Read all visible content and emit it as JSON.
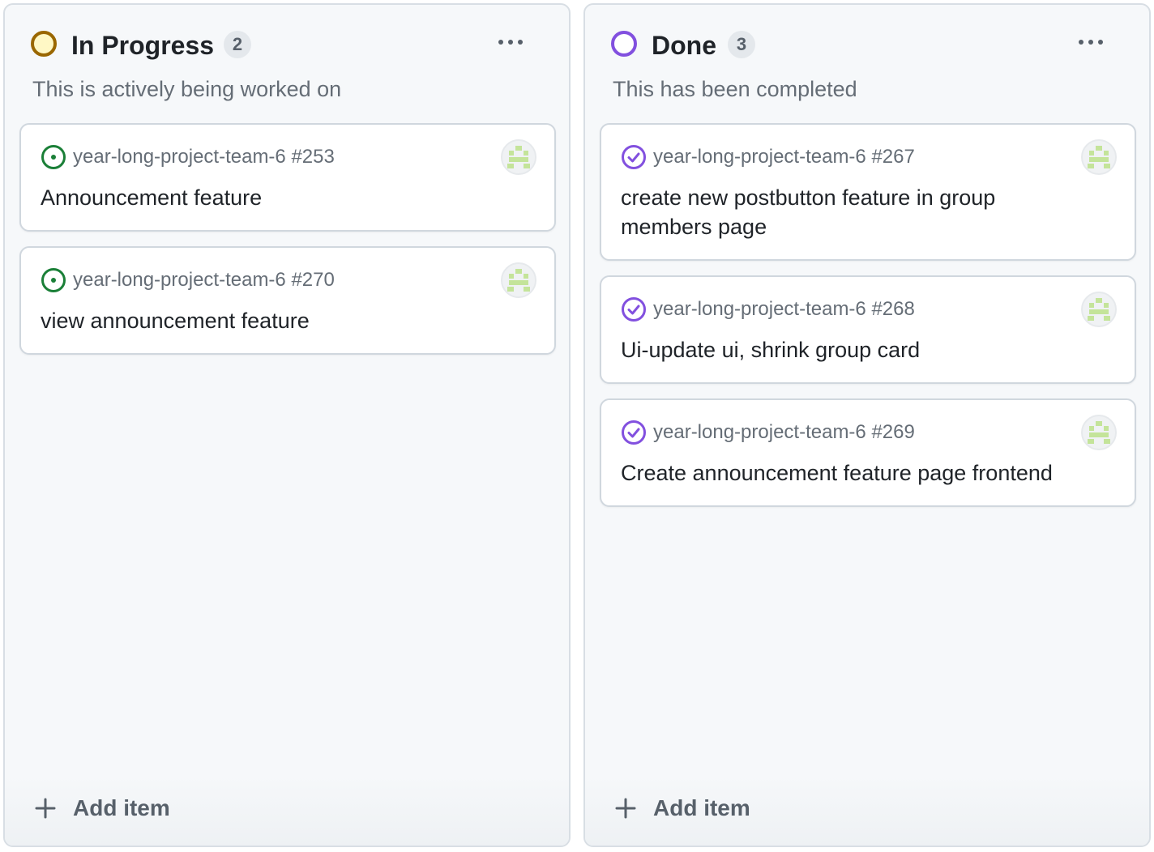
{
  "columns": [
    {
      "title": "In Progress",
      "count": "2",
      "description": "This is actively being worked on",
      "status_color": "#9a6700",
      "add_item_label": "Add item",
      "cards": [
        {
          "repo": "year-long-project-team-6",
          "number": "#253",
          "title": "Announcement feature",
          "state_icon": "issue-open-icon",
          "state_color": "#1a7f37"
        },
        {
          "repo": "year-long-project-team-6",
          "number": "#270",
          "title": "view announcement feature",
          "state_icon": "issue-open-icon",
          "state_color": "#1a7f37"
        }
      ]
    },
    {
      "title": "Done",
      "count": "3",
      "description": "This has been completed",
      "status_color": "#8250df",
      "add_item_label": "Add item",
      "cards": [
        {
          "repo": "year-long-project-team-6",
          "number": "#267",
          "title": "create new postbutton feature in group members page",
          "state_icon": "issue-closed-icon",
          "state_color": "#8250df"
        },
        {
          "repo": "year-long-project-team-6",
          "number": "#268",
          "title": "Ui-update ui, shrink group card",
          "state_icon": "issue-closed-icon",
          "state_color": "#8250df"
        },
        {
          "repo": "year-long-project-team-6",
          "number": "#269",
          "title": "Create announcement feature page frontend",
          "state_icon": "issue-closed-icon",
          "state_color": "#8250df"
        }
      ]
    }
  ]
}
